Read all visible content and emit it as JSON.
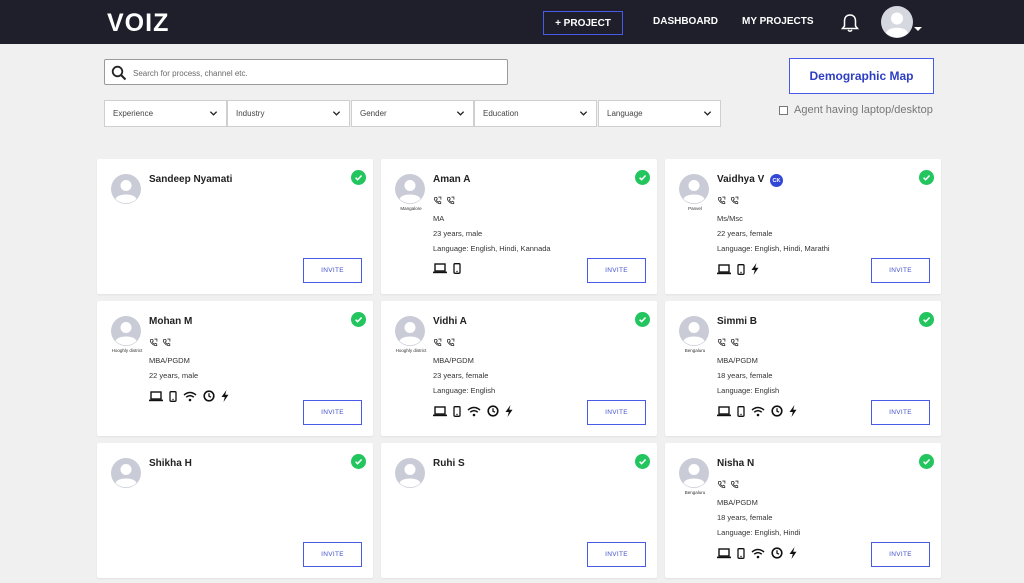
{
  "header": {
    "logo": "VOIZ",
    "project_button": "+ PROJECT",
    "nav": [
      "DASHBOARD",
      "MY PROJECTS"
    ]
  },
  "search": {
    "placeholder": "Search for process, channel etc."
  },
  "demographic_button": "Demographic Map",
  "laptop_filter_label": "Agent having laptop/desktop",
  "filters": [
    "Experience",
    "Industry",
    "Gender",
    "Education",
    "Language"
  ],
  "invite_label": "INVITE",
  "candidates": [
    {
      "name": "Sandeep Nyamati",
      "location": "",
      "badge": "",
      "qualification": "",
      "age_gender": "",
      "language": "",
      "icons": []
    },
    {
      "name": "Aman A",
      "location": "Mangalore",
      "badge": "",
      "qualification": "MA",
      "age_gender": "23 years, male",
      "language": "Language: English, Hindi, Kannada",
      "icons": [
        "laptop-icon",
        "mobile-icon"
      ]
    },
    {
      "name": "Vaidhya V",
      "location": "Panvel",
      "badge": "CK",
      "qualification": "Ms/Msc",
      "age_gender": "22 years, female",
      "language": "Language: English, Hindi, Marathi",
      "icons": [
        "laptop-icon",
        "mobile-icon",
        "power-icon"
      ]
    },
    {
      "name": "Mohan M",
      "location": "Hooghly district",
      "badge": "",
      "qualification": "MBA/PGDM",
      "age_gender": "22 years, male",
      "language": "",
      "icons": [
        "laptop-icon",
        "mobile-icon",
        "wifi-icon",
        "clock-icon",
        "power-icon"
      ]
    },
    {
      "name": "Vidhi A",
      "location": "Hooghly district",
      "badge": "",
      "qualification": "MBA/PGDM",
      "age_gender": "23 years, female",
      "language": "Language: English",
      "icons": [
        "laptop-icon",
        "mobile-icon",
        "wifi-icon",
        "clock-icon",
        "power-icon"
      ]
    },
    {
      "name": "Simmi B",
      "location": "Bengaluru",
      "badge": "",
      "qualification": "MBA/PGDM",
      "age_gender": "18 years, female",
      "language": "Language: English",
      "icons": [
        "laptop-icon",
        "mobile-icon",
        "wifi-icon",
        "clock-icon",
        "power-icon"
      ]
    },
    {
      "name": "Shikha H",
      "location": "",
      "badge": "",
      "qualification": "",
      "age_gender": "",
      "language": "",
      "icons": []
    },
    {
      "name": "Ruhi S",
      "location": "",
      "badge": "",
      "qualification": "",
      "age_gender": "",
      "language": "",
      "icons": []
    },
    {
      "name": "Nisha N",
      "location": "Bengaluru",
      "badge": "",
      "qualification": "MBA/PGDM",
      "age_gender": "18 years, female",
      "language": "Language: English, Hindi",
      "icons": [
        "laptop-icon",
        "mobile-icon",
        "wifi-icon",
        "clock-icon",
        "power-icon"
      ]
    }
  ],
  "colors": {
    "topbar": "#1f1f2b",
    "accent": "#4a5ae8",
    "check": "#22c55e",
    "background": "#f0f0f0"
  }
}
